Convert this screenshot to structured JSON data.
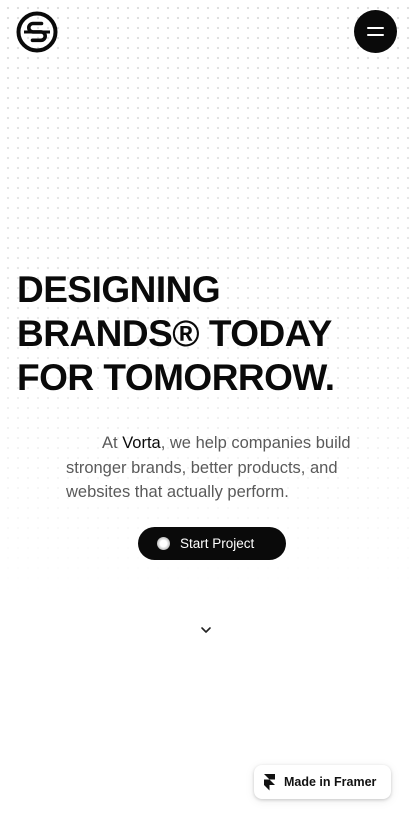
{
  "header": {
    "logo_icon": "s-circle-logo-icon",
    "menu_icon": "hamburger-menu-icon"
  },
  "hero": {
    "headline_lines": [
      "DESIGNING",
      "BRANDS® TODAY",
      "FOR TOMORROW."
    ],
    "intro": {
      "prefix": "At ",
      "brand": "Vorta",
      "line1_rest": ", we help companies build",
      "line2": "stronger brands, better products, and",
      "line3": "websites that actually perform."
    },
    "cta_label": "Start Project",
    "scroll_icon": "chevron-down-icon"
  },
  "badge": {
    "label": "Made in Framer",
    "icon": "framer-icon"
  },
  "colors": {
    "background": "#ffffff",
    "ink": "#0a0a0a",
    "muted_text": "#5a5a5a",
    "dot_pattern": "#d9d9d9"
  }
}
